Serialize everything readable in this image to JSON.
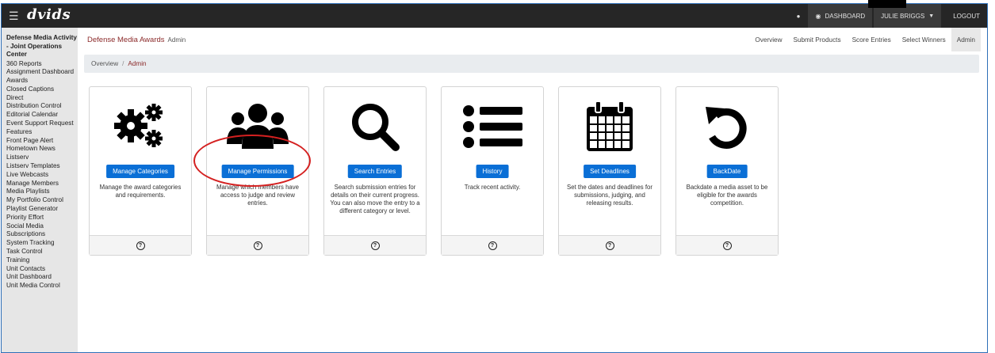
{
  "topbar": {
    "logo": "dvids",
    "dashboard": "DASHBOARD",
    "user": "JULIE BRIGGS",
    "logout": "LOGOUT"
  },
  "sidebar": {
    "org": "Defense Media Activity - Joint Operations Center",
    "items": [
      "360 Reports",
      "Assignment Dashboard",
      "Awards",
      "Closed Captions",
      "Direct",
      "Distribution Control",
      "Editorial Calendar",
      "Event Support Request",
      "Features",
      "Front Page Alert",
      "Hometown News",
      "Listserv",
      "Listserv Templates",
      "Live Webcasts",
      "Manage Members",
      "Media Playlists",
      "My Portfolio Control",
      "Playlist Generator",
      "Priority Effort",
      "Social Media",
      "Subscriptions",
      "System Tracking",
      "Task Control",
      "Training",
      "Unit Contacts",
      "Unit Dashboard",
      "Unit Media Control"
    ]
  },
  "subnav": {
    "brand": "Defense Media Awards",
    "brand_sub": "Admin",
    "links": [
      "Overview",
      "Submit Products",
      "Score Entries",
      "Select Winners",
      "Admin"
    ]
  },
  "breadcrumb": {
    "overview": "Overview",
    "sep": "/",
    "current": "Admin"
  },
  "cards": [
    {
      "icon": "gears-icon",
      "button": "Manage Categories",
      "desc": "Manage the award categories and requirements.",
      "help": "?"
    },
    {
      "icon": "users-icon",
      "button": "Manage Permissions",
      "desc": "Manage which members have access to judge and review entries.",
      "help": "?"
    },
    {
      "icon": "search-icon",
      "button": "Search Entries",
      "desc": "Search submission entries for details on their current progress. You can also move the entry to a different category or level.",
      "help": "?"
    },
    {
      "icon": "list-icon",
      "button": "History",
      "desc": "Track recent activity.",
      "help": "?"
    },
    {
      "icon": "calendar-icon",
      "button": "Set Deadlines",
      "desc": "Set the dates and deadlines for submissions, judging, and releasing results.",
      "help": "?"
    },
    {
      "icon": "undo-icon",
      "button": "BackDate",
      "desc": "Backdate a media asset to be eligible for the awards competition.",
      "help": "?"
    }
  ],
  "colors": {
    "accent": "#0a6fd6",
    "brand": "#8b2a2a",
    "annotation": "#d42020"
  }
}
